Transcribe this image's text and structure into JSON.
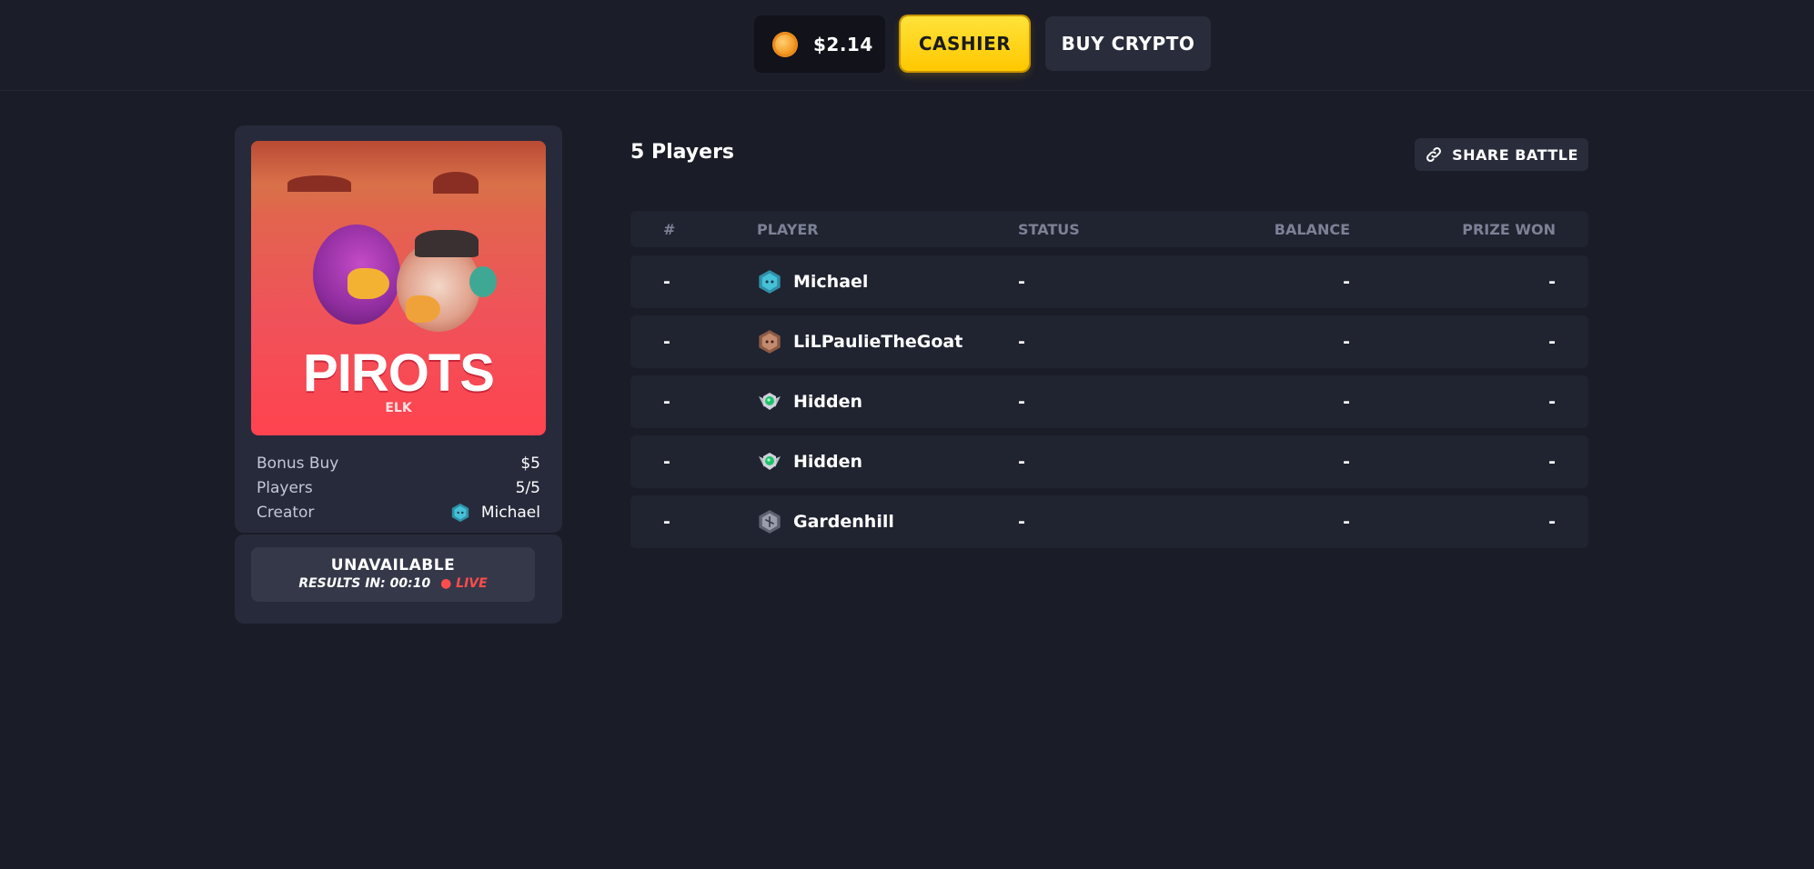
{
  "header": {
    "wallet_amount": "$2.14",
    "cashier_label": "CASHIER",
    "buy_crypto_label": "BUY CRYPTO"
  },
  "game": {
    "title": "PIROTS",
    "provider": "ELK",
    "info": [
      {
        "label": "Bonus Buy",
        "value": "$5"
      },
      {
        "label": "Players",
        "value": "5/5"
      },
      {
        "label": "Creator",
        "value": "Michael"
      }
    ],
    "status": "UNAVAILABLE",
    "results_in": "RESULTS IN: 00:10",
    "live": "LIVE"
  },
  "players_section": {
    "title": "5 Players",
    "share_label": "SHARE BATTLE",
    "columns": [
      "#",
      "PLAYER",
      "STATUS",
      "BALANCE",
      "PRIZE WON"
    ],
    "rows": [
      {
        "num": "-",
        "player": "Michael",
        "avatar": "cyan-cube-icon",
        "status": "-",
        "balance": "-",
        "prize": "-"
      },
      {
        "num": "-",
        "player": "LiLPaulieTheGoat",
        "avatar": "bronze-cube-icon",
        "status": "-",
        "balance": "-",
        "prize": "-"
      },
      {
        "num": "-",
        "player": "Hidden",
        "avatar": "emerald-wings-icon",
        "status": "-",
        "balance": "-",
        "prize": "-"
      },
      {
        "num": "-",
        "player": "Hidden",
        "avatar": "emerald-wings-icon",
        "status": "-",
        "balance": "-",
        "prize": "-"
      },
      {
        "num": "-",
        "player": "Gardenhill",
        "avatar": "silver-cube-icon",
        "status": "-",
        "balance": "-",
        "prize": "-"
      }
    ]
  },
  "colors": {
    "background": "#1a1c27",
    "accent_yellow": "#ffd21a",
    "live_red": "#ff4c4c",
    "panel": "#272a3a"
  }
}
